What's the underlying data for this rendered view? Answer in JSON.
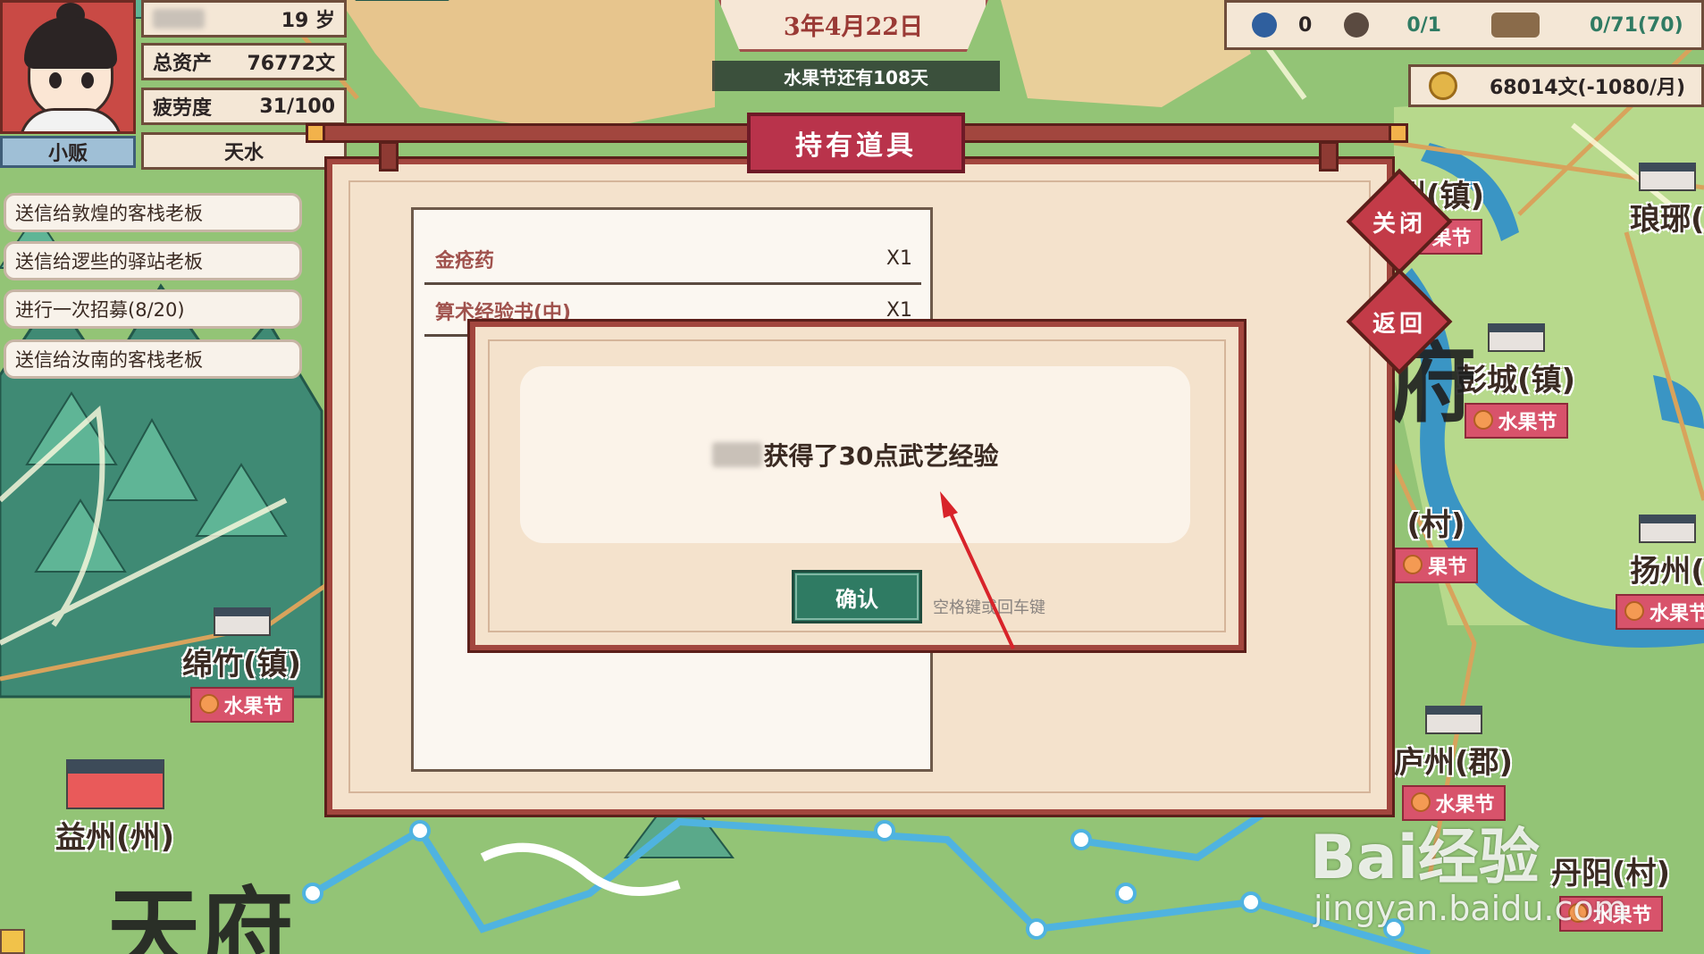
{
  "player": {
    "age": "19 岁",
    "assets_label": "总资产",
    "assets_value": "76772文",
    "fatigue_label": "疲劳度",
    "fatigue_value": "31/100",
    "role": "小贩",
    "location": "天水"
  },
  "quests": [
    "送信给敦煌的客栈老板",
    "送信给逻些的驿站老板",
    "进行一次招募(8/20)",
    "送信给汝南的客栈老板"
  ],
  "header": {
    "date": "3年4月22日",
    "festival_countdown": "水果节还有108天"
  },
  "resources": {
    "res1_value": "0",
    "res2_value": "0/1",
    "res3_value": "0/71(70)",
    "money": "68014文(-1080/月)"
  },
  "panel": {
    "title": "持有道具",
    "items": [
      {
        "name": "金疮药",
        "qty": "X1"
      },
      {
        "name": "算术经验书(中)",
        "qty": "X1"
      }
    ],
    "close_label": "关闭",
    "back_label": "返回"
  },
  "modal": {
    "message": "获得了30点武艺经验",
    "confirm_label": "确认",
    "hint": "空格键或回车键"
  },
  "map": {
    "towns": [
      {
        "name": "州(镇)",
        "tag": "果节"
      },
      {
        "name": "琅琊(",
        "tag": ""
      },
      {
        "name": "彭城(镇)",
        "tag": "水果节"
      },
      {
        "name": "(村)",
        "tag": "果节"
      },
      {
        "name": "扬州(",
        "tag": "水果节"
      },
      {
        "name": "庐州(郡)",
        "tag": "水果节"
      },
      {
        "name": "丹阳(村)",
        "tag": "水果节"
      },
      {
        "name": "绵竹(镇)",
        "tag": "水果节"
      },
      {
        "name": "益州(州)",
        "tag": ""
      }
    ],
    "region_labels": [
      "天府",
      "府"
    ]
  },
  "watermark": {
    "logo": "Bai经验",
    "url": "jingyan.baidu.com"
  },
  "colors": {
    "accent_red": "#b9334b",
    "confirm_green": "#2f7b63",
    "panel_bg": "#f4e2cc"
  },
  "annotation": {
    "arrow_color": "#d8232a"
  }
}
